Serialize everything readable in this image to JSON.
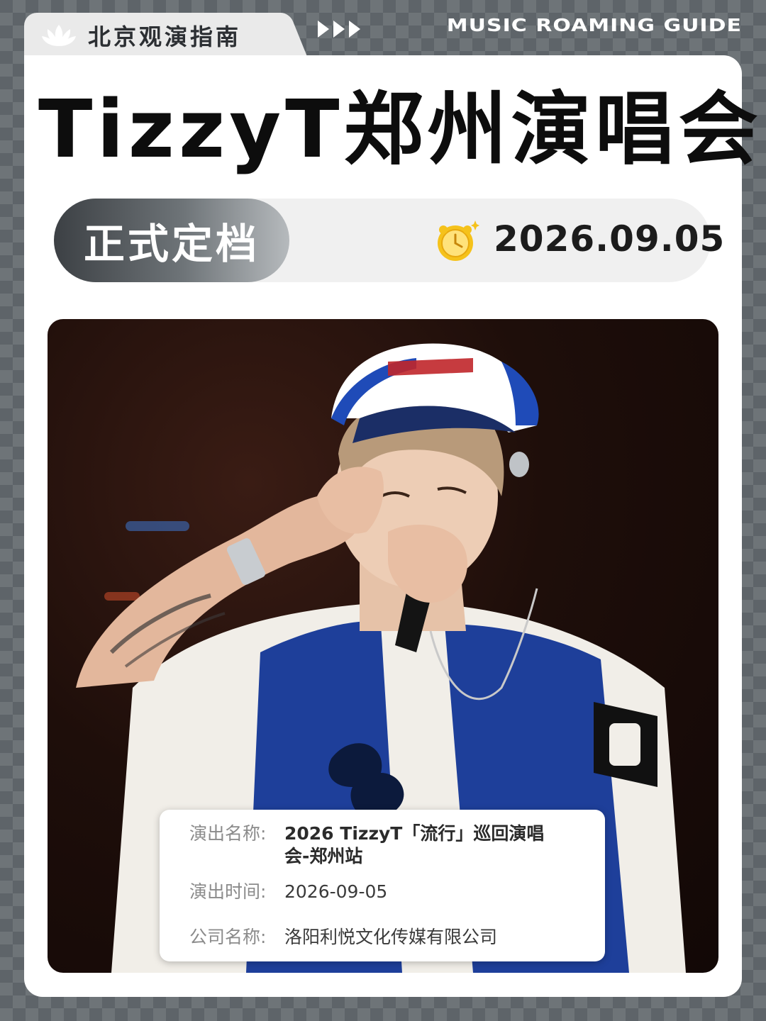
{
  "header": {
    "brand": "北京观演指南",
    "brand_icon": "lotus-icon",
    "arrows_icon": "triple-arrow-icon",
    "tagline": "MUSIC ROAMING GUIDE"
  },
  "headline": "TizzyT郑州演唱会",
  "status": {
    "label": "正式定档",
    "date_icon": "alarm-clock-icon",
    "date": "2026.09.05"
  },
  "photo": {
    "description_icon": "performer-photo"
  },
  "info": {
    "name_label": "演出名称:",
    "name_value": "2026 TizzyT「流行」巡回演唱会-郑州站",
    "time_label": "演出时间:",
    "time_value": "2026-09-05",
    "company_label": "公司名称:",
    "company_value": "洛阳利悦文化传媒有限公司"
  },
  "colors": {
    "background": "#5e6469",
    "card": "#ffffff",
    "headline": "#0d0d0d",
    "pill_dark": "#3c4044",
    "clock_yellow": "#f5c21b"
  }
}
